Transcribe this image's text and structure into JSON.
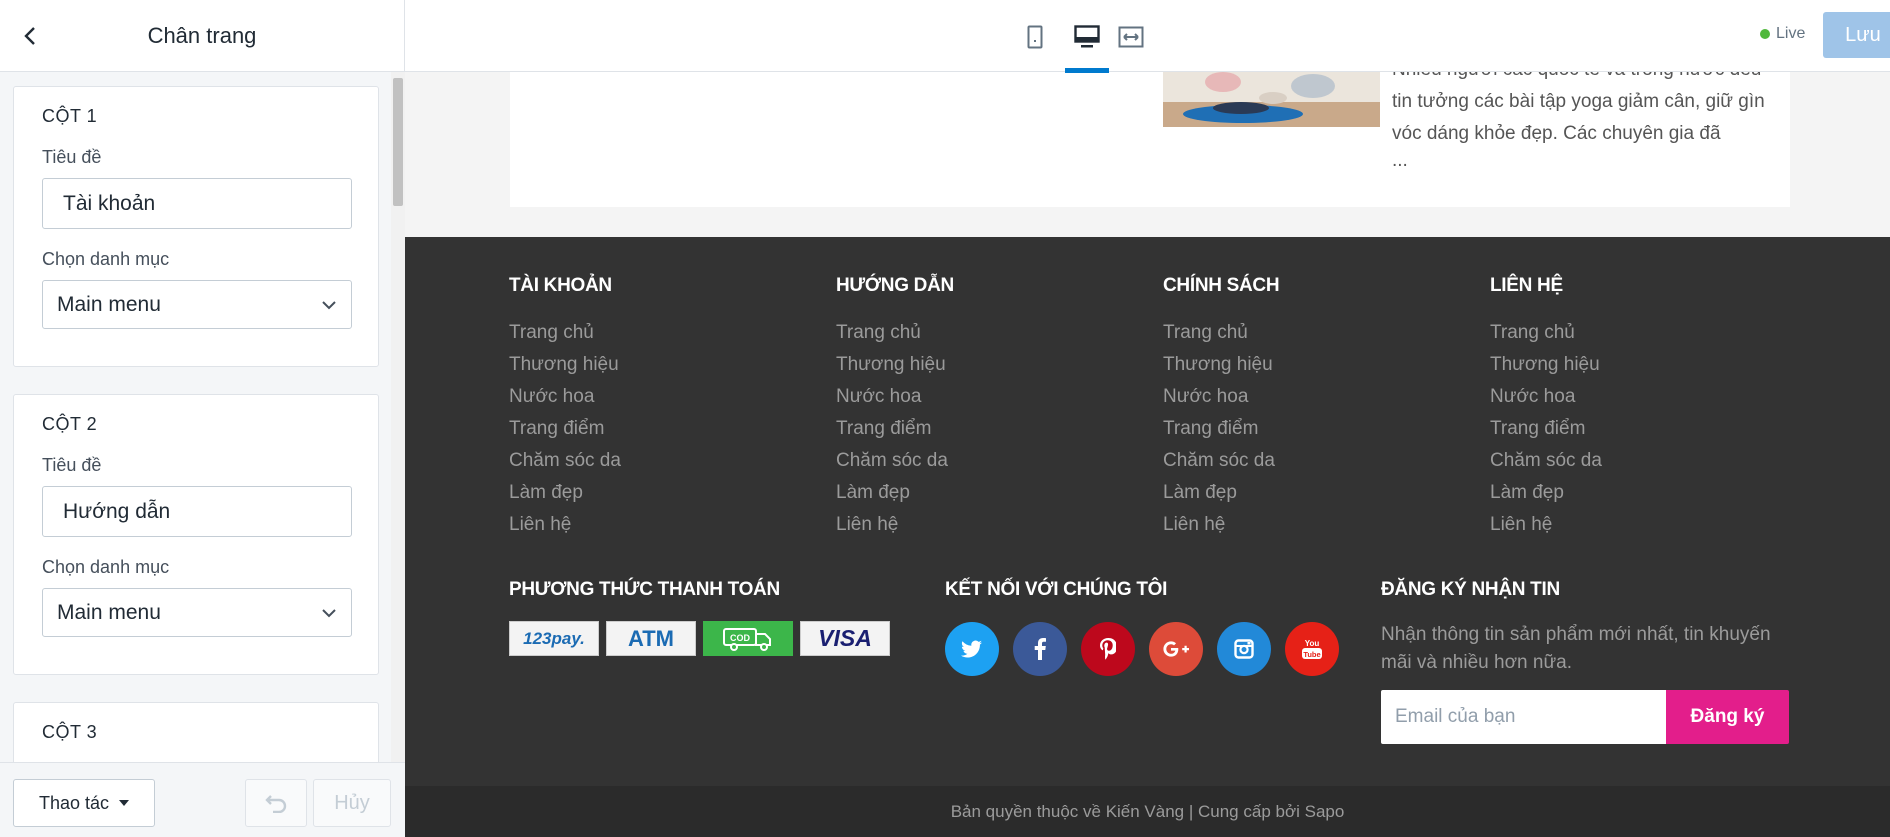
{
  "sidebar": {
    "title": "Chân trang",
    "columns": [
      {
        "heading": "CỘT 1",
        "title_label": "Tiêu đề",
        "title_value": "Tài khoản",
        "menu_label": "Chọn danh mục",
        "menu_value": "Main menu"
      },
      {
        "heading": "CỘT 2",
        "title_label": "Tiêu đề",
        "title_value": "Hướng dẫn",
        "menu_label": "Chọn danh mục",
        "menu_value": "Main menu"
      },
      {
        "heading": "CỘT 3"
      }
    ],
    "footer": {
      "actions_label": "Thao tác",
      "cancel_label": "Hủy"
    }
  },
  "topbar": {
    "status": "Live",
    "save_label": "Lưu",
    "active_device": "desktop"
  },
  "preview": {
    "post": {
      "excerpt": "Nhiều người các quốc tế và trong nước đều tin tưởng các bài tập yoga giảm cân, giữ gìn vóc dáng khỏe đẹp. Các chuyên gia đã",
      "ellipsis": "..."
    },
    "footer": {
      "columns": [
        {
          "heading": "TÀI KHOẢN",
          "links": [
            "Trang chủ",
            "Thương hiệu",
            "Nước hoa",
            "Trang điểm",
            "Chăm sóc da",
            "Làm đẹp",
            "Liên hệ"
          ]
        },
        {
          "heading": "HƯỚNG DẪN",
          "links": [
            "Trang chủ",
            "Thương hiệu",
            "Nước hoa",
            "Trang điểm",
            "Chăm sóc da",
            "Làm đẹp",
            "Liên hệ"
          ]
        },
        {
          "heading": "CHÍNH SÁCH",
          "links": [
            "Trang chủ",
            "Thương hiệu",
            "Nước hoa",
            "Trang điểm",
            "Chăm sóc da",
            "Làm đẹp",
            "Liên hệ"
          ]
        },
        {
          "heading": "LIÊN HỆ",
          "links": [
            "Trang chủ",
            "Thương hiệu",
            "Nước hoa",
            "Trang điểm",
            "Chăm sóc da",
            "Làm đẹp",
            "Liên hệ"
          ]
        }
      ],
      "payment": {
        "heading": "PHƯƠNG THỨC THANH TOÁN",
        "methods": [
          {
            "icon": "123pay-logo",
            "text": "123pay."
          },
          {
            "icon": "atm-logo",
            "text": "ATM"
          },
          {
            "icon": "cod-truck-icon",
            "text": "COD"
          },
          {
            "icon": "visa-logo",
            "text": "VISA"
          }
        ]
      },
      "social": {
        "heading": "KẾT NỐI VỚI CHÚNG TÔI",
        "items": [
          {
            "icon": "twitter-icon",
            "color": "#1da1f2"
          },
          {
            "icon": "facebook-icon",
            "color": "#3b5998"
          },
          {
            "icon": "pinterest-icon",
            "color": "#bd081c"
          },
          {
            "icon": "google-plus-icon",
            "color": "#dd4b39"
          },
          {
            "icon": "instagram-icon",
            "color": "#2289d8"
          },
          {
            "icon": "youtube-icon",
            "color": "#e62117"
          }
        ]
      },
      "newsletter": {
        "heading": "ĐĂNG KÝ NHẬN TIN",
        "text": "Nhận thông tin sản phẩm mới nhất, tin khuyến mãi và nhiều hơn nữa.",
        "placeholder": "Email của bạn",
        "button": "Đăng ký"
      },
      "copyright": "Bản quyền thuộc về Kiến Vàng | Cung cấp bởi Sapo"
    }
  },
  "colors": {
    "accent": "#007ace",
    "save_button": "#9fc4e8",
    "subscribe": "#e31e8b",
    "footer_bg": "#333333",
    "live": "#50b83c"
  }
}
